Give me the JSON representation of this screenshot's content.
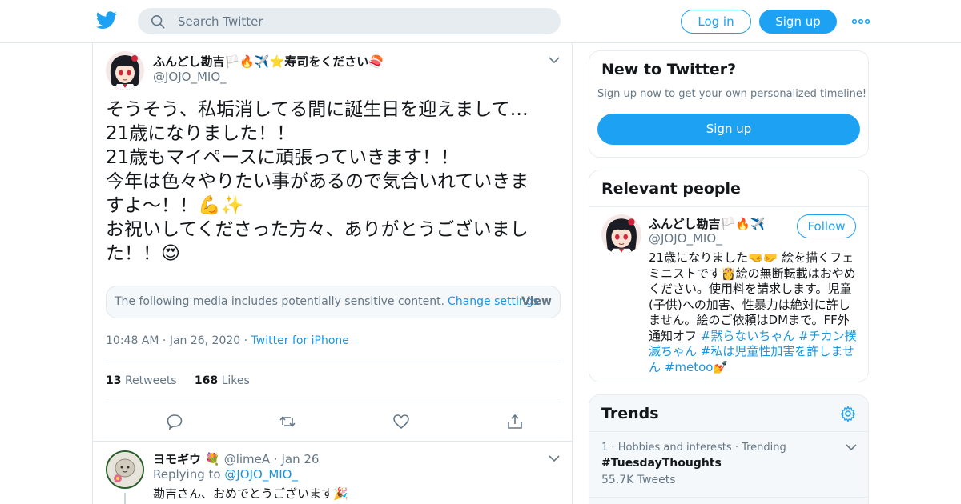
{
  "header": {
    "search_placeholder": "Search Twitter",
    "login_label": "Log in",
    "signup_label": "Sign up"
  },
  "tweet": {
    "display_name": "ふんどし勘吉🏳️🔥✈️⭐寿司をください🍣",
    "handle": "@JOJO_MIO_",
    "lines": [
      "そうそう、私垢消してる間に誕生日を迎えまして…",
      "21歳になりました！！",
      "21歳もマイペースに頑張っていきます！！",
      "今年は色々やりたい事があるので気合いれていきま",
      "すよ〜！！💪✨",
      "お祝いしてくださった方々、ありがとうございまし",
      "た！！😍"
    ],
    "sensitive_message": "The following media includes potentially sensitive content.",
    "change_settings_label": "Change settings",
    "view_label": "View",
    "time": "10:48 AM",
    "date": "Jan 26, 2020",
    "source": "Twitter for iPhone",
    "retweets_count": "13",
    "retweets_label": "Retweets",
    "likes_count": "168",
    "likes_label": "Likes"
  },
  "reply": {
    "display_name": "ヨモギウ 💐",
    "handle": "@limeA",
    "date": "Jan 26",
    "replying_label": "Replying to",
    "replying_to": "@JOJO_MIO_",
    "text": "勘吉さん、おめでとうございます🎉"
  },
  "new_to_twitter": {
    "title": "New to Twitter?",
    "subtitle": "Sign up now to get your own personalized timeline!",
    "button_label": "Sign up"
  },
  "relevant_people": {
    "title": "Relevant people",
    "name": "ふんどし勘吉🏳️🔥✈️",
    "handle": "@JOJO_MIO_",
    "follow_label": "Follow",
    "bio_parts": {
      "p1": "21歳になりました🤜🤛 絵を描くフェミニストです👸絵の無断転載はおやめください。使用料を請求します。児童(子供)への加害、性暴力は絶対に許しません。絵のご依頼はDMまで。FF外通知オフ",
      "h1": "#黙らないちゃん",
      "h2": "#チカン撲滅ちゃん",
      "h3": "#私は児童性加害を許しません",
      "h4": "#metoo",
      "end": "💅"
    }
  },
  "trends": {
    "title": "Trends",
    "items": [
      {
        "rank": "1",
        "category": "Hobbies and interests",
        "status": "Trending",
        "name": "#TuesdayThoughts",
        "count": "55.7K Tweets"
      }
    ]
  },
  "colors": {
    "brand_blue": "#1da1f2",
    "link_blue": "#1b95e0",
    "muted": "#657786",
    "border": "#e1e8ed"
  }
}
